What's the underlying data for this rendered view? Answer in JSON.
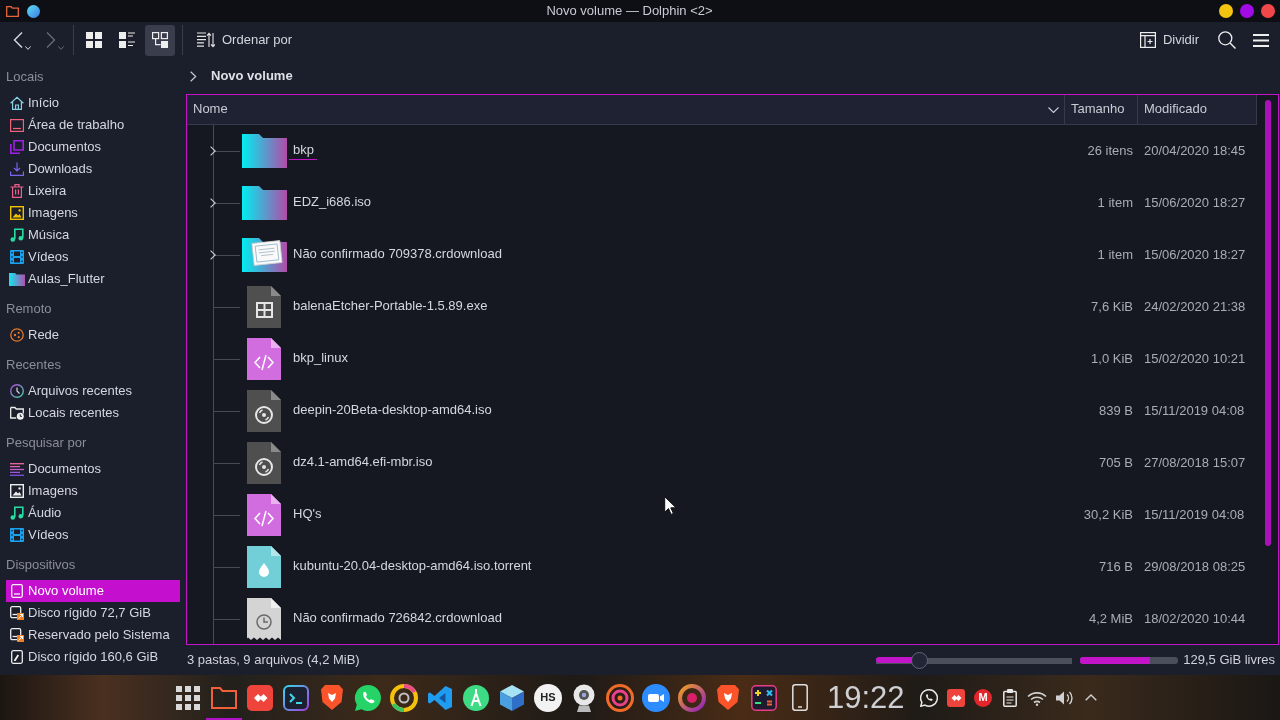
{
  "window": {
    "title": "Novo volume — Dolphin <2>",
    "controls": [
      {
        "kind": "minimize"
      },
      {
        "kind": "maximize"
      },
      {
        "kind": "close"
      }
    ]
  },
  "toolbar": {
    "navigation": [
      {
        "kind": "back",
        "disabled": false
      },
      {
        "kind": "forward",
        "disabled": true
      }
    ],
    "view_modes": [
      {
        "kind": "icons",
        "selected": false
      },
      {
        "kind": "compact",
        "selected": false
      },
      {
        "kind": "details",
        "selected": true
      }
    ],
    "sort_label": "Ordenar por",
    "split_label": "Dividir"
  },
  "sidebar": {
    "sections": [
      {
        "title": "Locais",
        "items": [
          {
            "label": "Início",
            "kind": "home",
            "selected": false
          },
          {
            "label": "Área de trabalho",
            "kind": "desktop",
            "selected": false
          },
          {
            "label": "Documentos",
            "kind": "documents",
            "selected": false
          },
          {
            "label": "Downloads",
            "kind": "downloads",
            "selected": false
          },
          {
            "label": "Lixeira",
            "kind": "trash",
            "selected": false
          },
          {
            "label": "Imagens",
            "kind": "pictures",
            "selected": false
          },
          {
            "label": "Música",
            "kind": "music",
            "selected": false
          },
          {
            "label": "Vídeos",
            "kind": "videos",
            "selected": false
          },
          {
            "label": "Aulas_Flutter",
            "kind": "folder",
            "selected": false
          }
        ]
      },
      {
        "title": "Remoto",
        "items": [
          {
            "label": "Rede",
            "kind": "network",
            "selected": false
          }
        ]
      },
      {
        "title": "Recentes",
        "items": [
          {
            "label": "Arquivos recentes",
            "kind": "recent-files",
            "selected": false
          },
          {
            "label": "Locais recentes",
            "kind": "recent-places",
            "selected": false
          }
        ]
      },
      {
        "title": "Pesquisar por",
        "items": [
          {
            "label": "Documentos",
            "kind": "search-documents",
            "selected": false
          },
          {
            "label": "Imagens",
            "kind": "search-images",
            "selected": false
          },
          {
            "label": "Áudio",
            "kind": "search-audio",
            "selected": false
          },
          {
            "label": "Vídeos",
            "kind": "search-videos",
            "selected": false
          }
        ]
      },
      {
        "title": "Dispositivos",
        "items": [
          {
            "label": "Novo volume",
            "kind": "drive",
            "selected": true
          },
          {
            "label": "Disco rígido 72,7 GiB",
            "kind": "drive-badge",
            "selected": false
          },
          {
            "label": "Reservado pelo Sistema",
            "kind": "drive-badge",
            "selected": false
          },
          {
            "label": "Disco rígido 160,6 GiB",
            "kind": "drive-edit",
            "selected": false
          }
        ]
      }
    ]
  },
  "breadcrumb": [
    {
      "label": "Novo volume"
    }
  ],
  "table": {
    "columns": [
      {
        "label": "Nome",
        "sorted": true
      },
      {
        "label": "Tamanho",
        "sorted": false
      },
      {
        "label": "Modificado",
        "sorted": false
      }
    ],
    "rows": [
      {
        "name": "bkp",
        "size": "26 itens",
        "modified": "20/04/2020 18:45",
        "kind": "folder",
        "focused": true
      },
      {
        "name": "EDZ_i686.iso",
        "size": "1 item",
        "modified": "15/06/2020 18:27",
        "kind": "folder",
        "focused": false
      },
      {
        "name": "Não confirmado 709378.crdownload",
        "size": "1 item",
        "modified": "15/06/2020 18:27",
        "kind": "folder-preview",
        "focused": false
      },
      {
        "name": "balenaEtcher-Portable-1.5.89.exe",
        "size": "7,6 KiB",
        "modified": "24/02/2020 21:38",
        "kind": "executable",
        "focused": false
      },
      {
        "name": "bkp_linux",
        "size": "1,0 KiB",
        "modified": "15/02/2020 10:21",
        "kind": "script",
        "focused": false
      },
      {
        "name": "deepin-20Beta-desktop-amd64.iso",
        "size": "839 B",
        "modified": "15/11/2019 04:08",
        "kind": "disc-image",
        "focused": false
      },
      {
        "name": "dz4.1-amd64.efi-mbr.iso",
        "size": "705 B",
        "modified": "27/08/2018 15:07",
        "kind": "disc-image",
        "focused": false
      },
      {
        "name": "HQ's",
        "size": "30,2 KiB",
        "modified": "15/11/2019 04:08",
        "kind": "script",
        "focused": false
      },
      {
        "name": "kubuntu-20.04-desktop-amd64.iso.torrent",
        "size": "716 B",
        "modified": "29/08/2018 08:25",
        "kind": "torrent",
        "focused": false
      },
      {
        "name": "Não confirmado 726842.crdownload",
        "size": "4,2 MiB",
        "modified": "18/02/2020 10:44",
        "kind": "partial",
        "focused": false
      }
    ]
  },
  "status_bar": {
    "summary": "3 pastas, 9 arquivos (4,2 MiB)",
    "zoom": {
      "level": 0.22
    },
    "free_space": {
      "level": 0.71,
      "label": "129,5 GiB livres"
    }
  },
  "taskbar": {
    "apps": [
      {
        "kind": "launcher",
        "active": false
      },
      {
        "kind": "files",
        "active": true
      },
      {
        "kind": "remote",
        "active": false
      },
      {
        "kind": "terminal",
        "active": false
      },
      {
        "kind": "shield",
        "active": false
      },
      {
        "kind": "chat",
        "active": false
      },
      {
        "kind": "ring",
        "active": false
      },
      {
        "kind": "editor",
        "active": false
      },
      {
        "kind": "compass",
        "active": false
      },
      {
        "kind": "cube",
        "active": false
      },
      {
        "kind": "badge",
        "label": "HS",
        "active": false
      },
      {
        "kind": "webcam",
        "active": false
      },
      {
        "kind": "target",
        "active": false
      },
      {
        "kind": "meeting",
        "active": false
      },
      {
        "kind": "swirl",
        "active": false
      },
      {
        "kind": "shield",
        "active": false
      },
      {
        "kind": "calculator",
        "active": false
      },
      {
        "kind": "phone",
        "active": false
      }
    ],
    "clock": "19:22",
    "tray": [
      {
        "kind": "chat"
      },
      {
        "kind": "remote"
      },
      {
        "kind": "letter",
        "label": "M"
      },
      {
        "kind": "clipboard"
      },
      {
        "kind": "wifi"
      },
      {
        "kind": "volume"
      },
      {
        "kind": "expand"
      }
    ]
  }
}
